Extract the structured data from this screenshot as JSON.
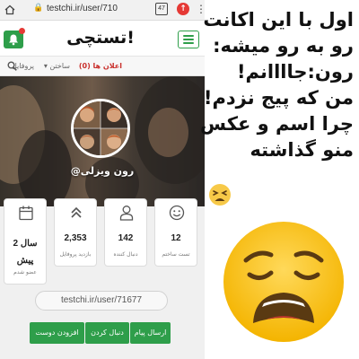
{
  "browser": {
    "url": "testchi.ir/user/710",
    "tab_count": "47",
    "lock_icon": "lock-icon",
    "alert_icon": "alert-icon"
  },
  "header": {
    "logo": "تستچی!",
    "bell_icon": "bell-icon",
    "menu_icon": "hamburger-icon"
  },
  "nav": {
    "profile": "پروفایل",
    "build": "ساختن ▾",
    "ads": "اعلان ها (0)",
    "search_icon": "search-icon"
  },
  "profile": {
    "username": "@رون ویزلی",
    "link": "testchi.ir/user/71677"
  },
  "stats": [
    {
      "icon": "smiley-icon",
      "value": "12",
      "label": "تست ساختم"
    },
    {
      "icon": "person-icon",
      "value": "142",
      "label": "دنبال کننده"
    },
    {
      "icon": "chevrons-up-icon",
      "value": "2,353",
      "label": "بازدید پروفایل"
    },
    {
      "icon": "calendar-icon",
      "value": "2 سال پیش",
      "label": "عضو شدم"
    }
  ],
  "buttons": {
    "send_message": "ارسال پیام",
    "follow": "دنبال کردن",
    "add_friend": "افزودن دوست"
  },
  "caption": {
    "line1": "اول با این اکانت",
    "line2": "رو به رو میشه:",
    "line3": "رون:جاااانم!",
    "line4": "من که پیج نزدم!",
    "line5": "چرا اسم و عکس",
    "line6": "منو گذاشته"
  },
  "colors": {
    "accent_green": "#2e9e4a",
    "alert_red": "#e53935",
    "emoji_yellow": "#f7c948"
  },
  "emojis": {
    "small": "tired-face-emoji",
    "large": "weary-face-emoji"
  }
}
